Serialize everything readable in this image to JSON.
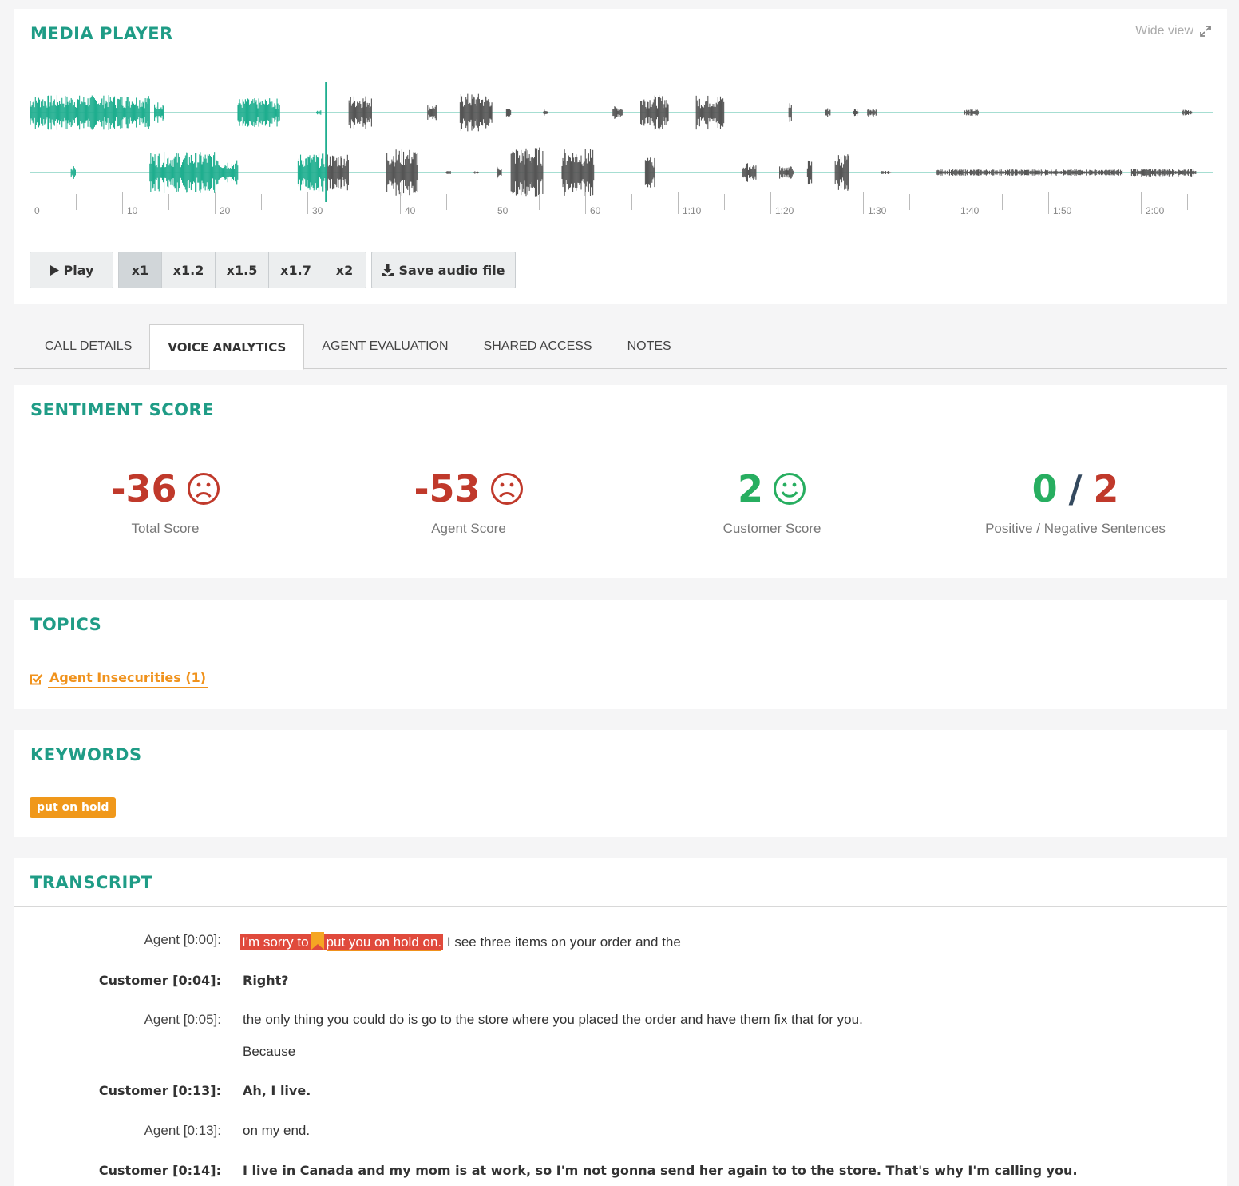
{
  "media_player": {
    "title": "MEDIA  PLAYER",
    "wide_view": "Wide  view",
    "timeline_labels": [
      "0",
      "10",
      "20",
      "30",
      "40",
      "50",
      "60",
      "1:10",
      "1:20",
      "1:30",
      "1:40",
      "1:50",
      "2:00"
    ],
    "played_color": "#1fae8f",
    "unplayed_color": "#555555",
    "playhead_seconds": 32,
    "controls": {
      "play": "Play",
      "speeds": [
        "x1",
        "x1.2",
        "x1.5",
        "x1.7",
        "x2"
      ],
      "active_speed": "x1",
      "save": "Save audio file"
    }
  },
  "tabs": {
    "call_details": "CALL DETAILS",
    "voice_analytics": "VOICE ANALYTICS",
    "agent_evaluation": "AGENT EVALUATION",
    "shared_access": "SHARED ACCESS",
    "notes": "NOTES",
    "active": "VOICE ANALYTICS"
  },
  "sentiment": {
    "title": "SENTIMENT  SCORE",
    "total": {
      "value": "-36",
      "label": "Total Score",
      "mood": "sad"
    },
    "agent": {
      "value": "-53",
      "label": "Agent Score",
      "mood": "sad"
    },
    "customer": {
      "value": "2",
      "label": "Customer Score",
      "mood": "happy"
    },
    "sentences": {
      "positive": "0",
      "separator": "/",
      "negative": "2",
      "label": "Positive / Negative Sentences"
    }
  },
  "topics": {
    "title": "TOPICS",
    "items": [
      {
        "label": "Agent Insecurities (1)",
        "checked": true
      }
    ]
  },
  "keywords": {
    "title": "KEYWORDS",
    "items": [
      "put on hold"
    ]
  },
  "transcript": {
    "title": "TRANSCRIPT",
    "lines": [
      {
        "speaker": "Agent [0:00]:",
        "hl_1": "I'm sorry to",
        "hl_2": "put you on hold on.",
        "text": " I see three items on your order and the"
      },
      {
        "speaker": "Customer [0:04]:",
        "text": "Right?"
      },
      {
        "speaker": "Agent [0:05]:",
        "text": "the only thing you could do is go to the store where you placed the order and have them fix that for you."
      },
      {
        "speaker": "",
        "text": "Because"
      },
      {
        "speaker": "Customer [0:13]:",
        "text": "Ah, I live."
      },
      {
        "speaker": "Agent [0:13]:",
        "text": "on my end."
      },
      {
        "speaker": "Customer [0:14]:",
        "text": "I live in Canada and my mom is at work, so I'm not gonna send her again to to the store. That's why I'm calling you."
      }
    ]
  }
}
